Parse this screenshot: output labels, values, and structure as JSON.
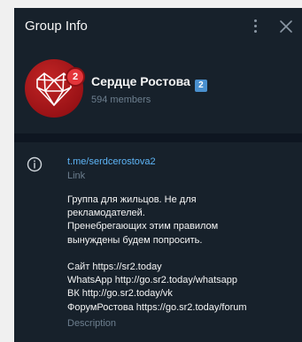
{
  "header": {
    "title": "Group Info",
    "menu_icon": "more-vertical-icon",
    "close_icon": "close-icon"
  },
  "profile": {
    "name": "Сердце Ростова",
    "verified_badge": "2",
    "notification_count": "2",
    "members": "594 members"
  },
  "info": {
    "link": "t.me/serdcerostova2",
    "link_label": "Link",
    "description_lines": [
      "Группа для жильцов. Не для",
      "рекламодателей.",
      "Пренебрегающих этим правилом",
      "вынуждены будем попросить.",
      "",
      "Сайт https://sr2.today",
      "WhatsApp http://go.sr2.today/whatsapp",
      "ВК http://go.sr2.today/vk",
      "ФорумРостова https://go.sr2.today/forum"
    ],
    "description_label": "Description"
  },
  "colors": {
    "background": "#17212b",
    "accent_link": "#5eb5f7",
    "muted": "#6d7f8f",
    "avatar_red": "#c22525"
  }
}
